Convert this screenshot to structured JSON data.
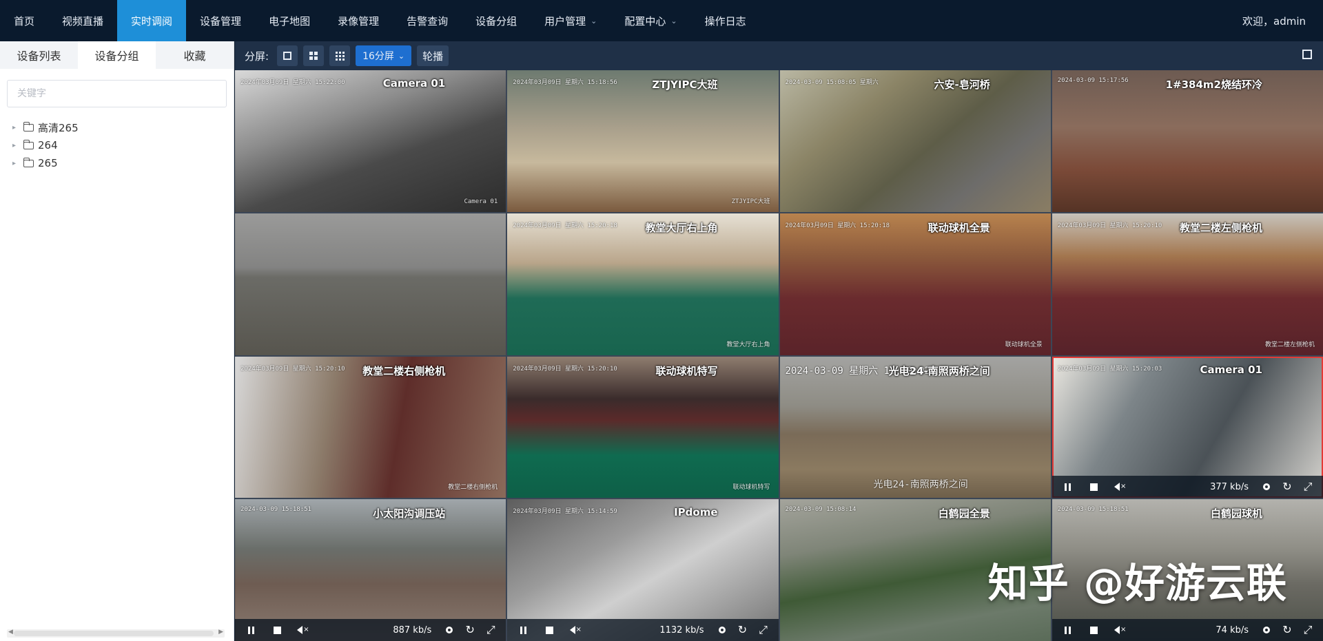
{
  "nav": {
    "items": [
      {
        "label": "首页"
      },
      {
        "label": "视频直播"
      },
      {
        "label": "实时调阅",
        "active": true
      },
      {
        "label": "设备管理"
      },
      {
        "label": "电子地图"
      },
      {
        "label": "录像管理"
      },
      {
        "label": "告警查询"
      },
      {
        "label": "设备分组"
      },
      {
        "label": "用户管理",
        "dropdown": true
      },
      {
        "label": "配置中心",
        "dropdown": true
      },
      {
        "label": "操作日志"
      }
    ],
    "welcome": "欢迎，admin"
  },
  "sidebar": {
    "tabs": [
      {
        "label": "设备列表"
      },
      {
        "label": "设备分组",
        "active": true
      },
      {
        "label": "收藏"
      }
    ],
    "search_placeholder": "关键字",
    "tree": [
      {
        "label": "高清265"
      },
      {
        "label": "264"
      },
      {
        "label": "265"
      }
    ]
  },
  "toolbar": {
    "label": "分屏:",
    "layout_selected": "16分屏",
    "carousel": "轮播"
  },
  "colors": {
    "topnav_bg": "#0a1a2d",
    "active_tab": "#1e8fd8",
    "toolbar_bg": "#1f3047",
    "primary_button": "#1e6fd0",
    "selected_border": "#e53935"
  },
  "cameras": [
    {
      "title": "Camera 01",
      "osd_top": "2024年03月09日 星期六 15:22:00",
      "osd_bottom": "Camera 01"
    },
    {
      "title": "ZTJYIPC大班",
      "osd_top": "2024年03月09日 星期六 15:18:56",
      "osd_bottom": "ZTJYIPC大班"
    },
    {
      "title": "六安-皂河桥",
      "osd_top": "2024-03-09 15:08:05 星期六",
      "osd_bottom": ""
    },
    {
      "title": "1#384m2烧结环冷",
      "osd_top": "2024-03-09 15:17:56",
      "osd_bottom": ""
    },
    {
      "title": "",
      "osd_top": "",
      "osd_bottom": ""
    },
    {
      "title": "教堂大厅右上角",
      "osd_top": "2024年03月09日 星期六 15:20:18",
      "osd_bottom": "教堂大厅右上角"
    },
    {
      "title": "联动球机全景",
      "osd_top": "2024年03月09日 星期六 15:20:18",
      "osd_bottom": "联动球机全景"
    },
    {
      "title": "教堂二楼左侧枪机",
      "osd_top": "2024年03月09日 星期六 15:20:10",
      "osd_bottom": "教堂二楼左侧枪机"
    },
    {
      "title": "教堂二楼右侧枪机",
      "osd_top": "2024年03月09日 星期六 15:20:10",
      "osd_bottom": "教堂二楼右侧枪机"
    },
    {
      "title": "联动球机特写",
      "osd_top": "2024年03月09日 星期六 15:20:10",
      "osd_bottom": "联动球机特写"
    },
    {
      "title": "光电24-南照两桥之间",
      "osd_top": "2024-03-09 星期六 15:19:02",
      "osd_bottom": "光电24-南照两桥之间"
    },
    {
      "title": "Camera 01",
      "osd_top": "2024年03月09日 星期六 15:20:03",
      "osd_bottom": "",
      "selected": true,
      "rate": "377 kb/s"
    },
    {
      "title": "小太阳沟调压站",
      "osd_top": "2024-03-09 15:18:51",
      "osd_bottom": "",
      "rate": "887 kb/s"
    },
    {
      "title": "IPdome",
      "osd_top": "2024年03月09日 星期六 15:14:59",
      "osd_bottom": "",
      "rate": "1132 kb/s"
    },
    {
      "title": "白鹤园全景",
      "osd_top": "2024-03-09 15:08:14",
      "osd_bottom": "",
      "rate": ""
    },
    {
      "title": "白鹤园球机",
      "osd_top": "2024-03-09 15:18:51",
      "osd_bottom": "",
      "rate": "74 kb/s"
    }
  ],
  "watermark": "知乎 @好游云联"
}
